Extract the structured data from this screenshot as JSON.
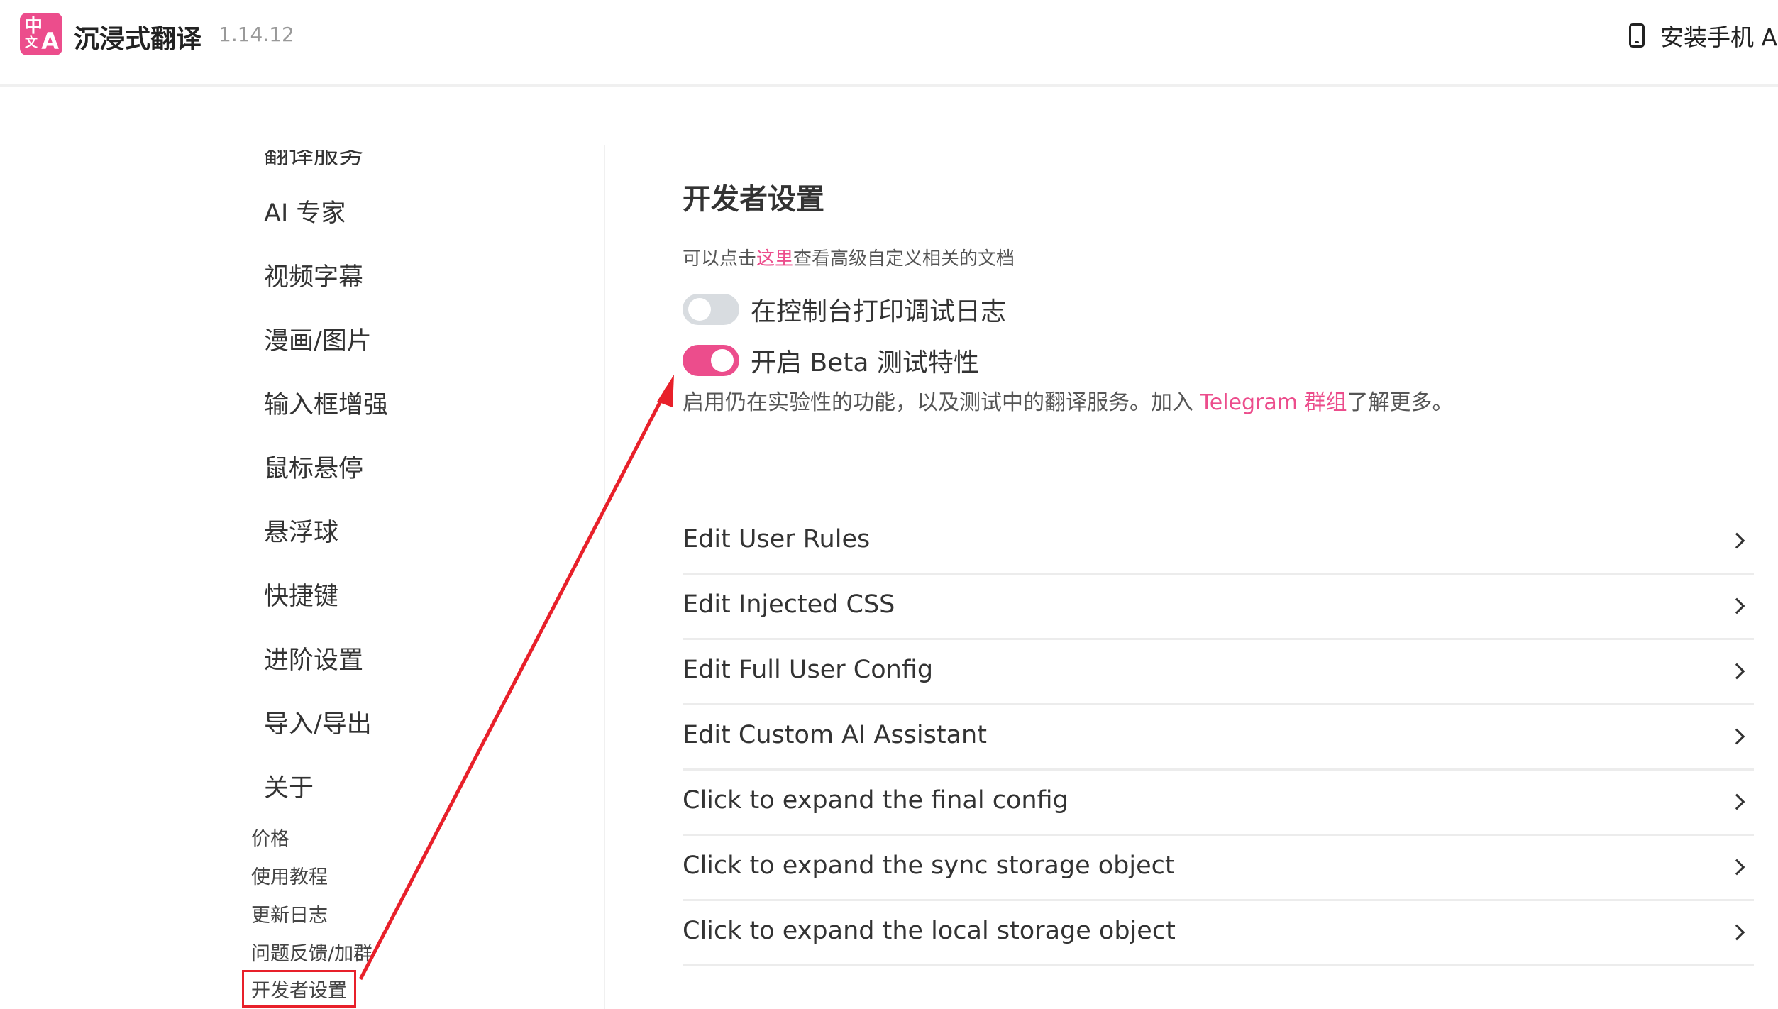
{
  "header": {
    "logo_text_top": "中",
    "logo_text_small": "文",
    "logo_text_a": "A",
    "app_title": "沉浸式翻译",
    "version": "1.14.12",
    "mobile_link": "安装手机 AI"
  },
  "sidebar": {
    "items": [
      {
        "label": "翻译服务"
      },
      {
        "label": "AI 专家"
      },
      {
        "label": "视频字幕"
      },
      {
        "label": "漫画/图片"
      },
      {
        "label": "输入框增强"
      },
      {
        "label": "鼠标悬停"
      },
      {
        "label": "悬浮球"
      },
      {
        "label": "快捷键"
      },
      {
        "label": "进阶设置"
      },
      {
        "label": "导入/导出"
      },
      {
        "label": "关于"
      }
    ],
    "links": [
      {
        "label": "价格"
      },
      {
        "label": "使用教程"
      },
      {
        "label": "更新日志"
      },
      {
        "label": "问题反馈/加群"
      },
      {
        "label": "开发者设置",
        "active": true
      }
    ]
  },
  "main": {
    "title": "开发者设置",
    "doc_hint_prefix": "可以点击",
    "doc_hint_link": "这里",
    "doc_hint_suffix": "查看高级自定义相关的文档",
    "toggles": [
      {
        "label": "在控制台打印调试日志",
        "enabled": false
      },
      {
        "label": "开启 Beta 测试特性",
        "enabled": true
      }
    ],
    "beta_desc_prefix": "启用仍在实验性的功能，以及测试中的翻译服务。加入 ",
    "beta_desc_link": "Telegram 群组",
    "beta_desc_suffix": "了解更多。",
    "menu": [
      {
        "label": "Edit User Rules"
      },
      {
        "label": "Edit Injected CSS"
      },
      {
        "label": "Edit Full User Config"
      },
      {
        "label": "Edit Custom AI Assistant"
      },
      {
        "label": "Click to expand the final config"
      },
      {
        "label": "Click to expand the sync storage object"
      },
      {
        "label": "Click to expand the local storage object"
      }
    ]
  },
  "colors": {
    "accent": "#ec4d8c",
    "annotation": "#e8202a"
  }
}
